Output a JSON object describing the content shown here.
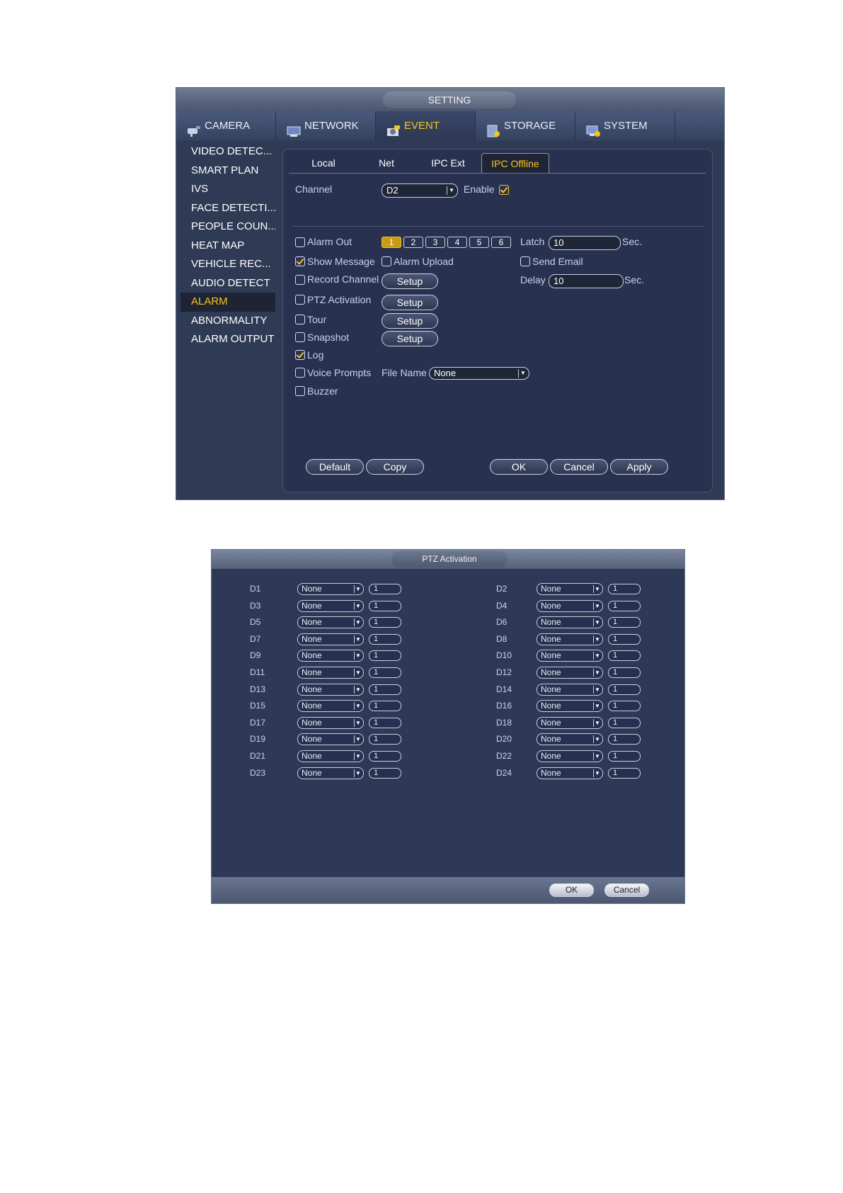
{
  "setting": {
    "title": "SETTING",
    "main_tabs": [
      {
        "label": "CAMERA",
        "icon": "camera-icon"
      },
      {
        "label": "NETWORK",
        "icon": "network-icon"
      },
      {
        "label": "EVENT",
        "icon": "event-icon"
      },
      {
        "label": "STORAGE",
        "icon": "storage-icon"
      },
      {
        "label": "SYSTEM",
        "icon": "system-icon"
      }
    ],
    "active_main_tab": "EVENT",
    "sidebar": [
      "VIDEO DETEC...",
      "SMART PLAN",
      "IVS",
      "FACE DETECTI...",
      "PEOPLE COUN...",
      "HEAT MAP",
      "VEHICLE REC...",
      "AUDIO DETECT",
      "ALARM",
      "ABNORMALITY",
      "ALARM OUTPUT"
    ],
    "active_sidebar": "ALARM",
    "sub_tabs": [
      "Local",
      "Net",
      "IPC Ext",
      "IPC Offline"
    ],
    "active_sub_tab": "IPC Offline",
    "channel_label": "Channel",
    "channel_value": "D2",
    "enable_label": "Enable",
    "enable_checked": true,
    "alarm_out_label": "Alarm Out",
    "alarm_out_checked": false,
    "alarm_out_numbers": [
      "1",
      "2",
      "3",
      "4",
      "5",
      "6"
    ],
    "alarm_out_selected": "1",
    "latch_label": "Latch",
    "latch_value": "10",
    "latch_unit": "Sec.",
    "show_message_label": "Show Message",
    "show_message_checked": true,
    "alarm_upload_label": "Alarm Upload",
    "alarm_upload_checked": false,
    "send_email_label": "Send Email",
    "send_email_checked": false,
    "record_channel_label": "Record Channel",
    "record_channel_checked": false,
    "delay_label": "Delay",
    "delay_value": "10",
    "delay_unit": "Sec.",
    "ptz_activation_label": "PTZ Activation",
    "ptz_activation_checked": false,
    "tour_label": "Tour",
    "tour_checked": false,
    "snapshot_label": "Snapshot",
    "snapshot_checked": false,
    "log_label": "Log",
    "log_checked": true,
    "voice_prompts_label": "Voice Prompts",
    "voice_prompts_checked": false,
    "file_name_label": "File Name",
    "file_name_value": "None",
    "buzzer_label": "Buzzer",
    "buzzer_checked": false,
    "setup_label": "Setup",
    "buttons": {
      "default": "Default",
      "copy": "Copy",
      "ok": "OK",
      "cancel": "Cancel",
      "apply": "Apply"
    }
  },
  "ptz": {
    "title": "PTZ Activation",
    "rows": [
      {
        "left": {
          "ch": "D1",
          "type": "None",
          "num": "1"
        },
        "right": {
          "ch": "D2",
          "type": "None",
          "num": "1"
        }
      },
      {
        "left": {
          "ch": "D3",
          "type": "None",
          "num": "1"
        },
        "right": {
          "ch": "D4",
          "type": "None",
          "num": "1"
        }
      },
      {
        "left": {
          "ch": "D5",
          "type": "None",
          "num": "1"
        },
        "right": {
          "ch": "D6",
          "type": "None",
          "num": "1"
        }
      },
      {
        "left": {
          "ch": "D7",
          "type": "None",
          "num": "1"
        },
        "right": {
          "ch": "D8",
          "type": "None",
          "num": "1"
        }
      },
      {
        "left": {
          "ch": "D9",
          "type": "None",
          "num": "1"
        },
        "right": {
          "ch": "D10",
          "type": "None",
          "num": "1"
        }
      },
      {
        "left": {
          "ch": "D11",
          "type": "None",
          "num": "1"
        },
        "right": {
          "ch": "D12",
          "type": "None",
          "num": "1"
        }
      },
      {
        "left": {
          "ch": "D13",
          "type": "None",
          "num": "1"
        },
        "right": {
          "ch": "D14",
          "type": "None",
          "num": "1"
        }
      },
      {
        "left": {
          "ch": "D15",
          "type": "None",
          "num": "1"
        },
        "right": {
          "ch": "D16",
          "type": "None",
          "num": "1"
        }
      },
      {
        "left": {
          "ch": "D17",
          "type": "None",
          "num": "1"
        },
        "right": {
          "ch": "D18",
          "type": "None",
          "num": "1"
        }
      },
      {
        "left": {
          "ch": "D19",
          "type": "None",
          "num": "1"
        },
        "right": {
          "ch": "D20",
          "type": "None",
          "num": "1"
        }
      },
      {
        "left": {
          "ch": "D21",
          "type": "None",
          "num": "1"
        },
        "right": {
          "ch": "D22",
          "type": "None",
          "num": "1"
        }
      },
      {
        "left": {
          "ch": "D23",
          "type": "None",
          "num": "1"
        },
        "right": {
          "ch": "D24",
          "type": "None",
          "num": "1"
        }
      }
    ],
    "ok_label": "OK",
    "cancel_label": "Cancel"
  },
  "colors": {
    "accent": "#f5c518",
    "window_bg": "#2f3a55",
    "panel_bg": "#283250"
  }
}
